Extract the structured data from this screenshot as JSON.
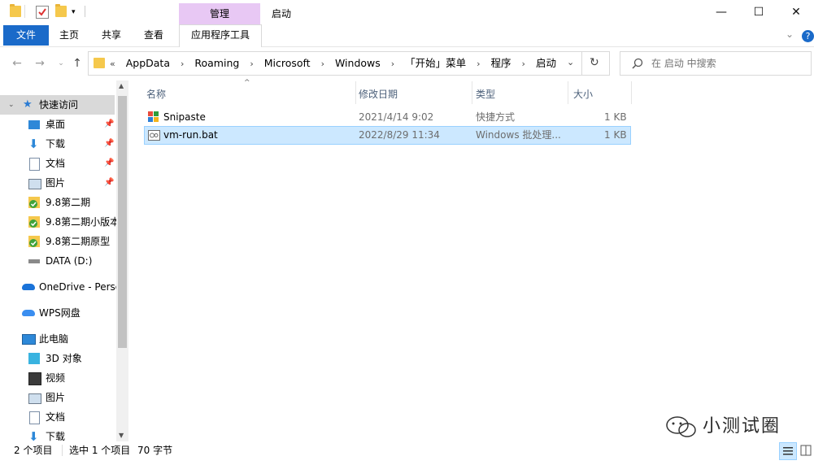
{
  "window": {
    "context_tab_group": "管理",
    "title": "启动",
    "controls": {
      "minimize": "—",
      "maximize": "☐",
      "close": "✕"
    }
  },
  "ribbon": {
    "tabs": [
      {
        "label": "文件",
        "active": true
      },
      {
        "label": "主页"
      },
      {
        "label": "共享"
      },
      {
        "label": "查看"
      },
      {
        "label": "应用程序工具"
      }
    ],
    "expand_icon": "chevron-down-icon",
    "help_icon": "help-icon"
  },
  "address": {
    "overflow": "«",
    "crumbs": [
      "AppData",
      "Roaming",
      "Microsoft",
      "Windows",
      "「开始」菜单",
      "程序",
      "启动"
    ],
    "separator": "›"
  },
  "search": {
    "placeholder": "在 启动 中搜索"
  },
  "nav": {
    "quick_access": "快速访问",
    "items": [
      {
        "label": "桌面",
        "icon": "desktop-icon",
        "pinned": true
      },
      {
        "label": "下载",
        "icon": "download-icon",
        "pinned": true
      },
      {
        "label": "文档",
        "icon": "document-icon",
        "pinned": true
      },
      {
        "label": "图片",
        "icon": "picture-icon",
        "pinned": true
      },
      {
        "label": "9.8第二期",
        "icon": "synced-folder-icon"
      },
      {
        "label": "9.8第二期小版本",
        "icon": "synced-folder-icon"
      },
      {
        "label": "9.8第二期原型",
        "icon": "synced-folder-icon"
      },
      {
        "label": "DATA (D:)",
        "icon": "drive-icon"
      }
    ],
    "onedrive": "OneDrive - Perso",
    "wps": "WPS网盘",
    "this_pc": "此电脑",
    "pc_items": [
      {
        "label": "3D 对象",
        "icon": "3d-object-icon"
      },
      {
        "label": "视频",
        "icon": "video-icon"
      },
      {
        "label": "图片",
        "icon": "picture-icon"
      },
      {
        "label": "文档",
        "icon": "document-icon"
      },
      {
        "label": "下载",
        "icon": "download-icon"
      }
    ]
  },
  "columns": {
    "name": "名称",
    "date": "修改日期",
    "type": "类型",
    "size": "大小"
  },
  "files": [
    {
      "name": "Snipaste",
      "date": "2021/4/14 9:02",
      "type": "快捷方式",
      "size": "1 KB",
      "icon": "shortcut-icon",
      "selected": false
    },
    {
      "name": "vm-run.bat",
      "date": "2022/8/29 11:34",
      "type": "Windows 批处理...",
      "size": "1 KB",
      "icon": "batch-file-icon",
      "selected": true
    }
  ],
  "status": {
    "count": "2 个项目",
    "selection": "选中 1 个项目",
    "bytes": "70 字节"
  },
  "watermark": "小测试圈"
}
